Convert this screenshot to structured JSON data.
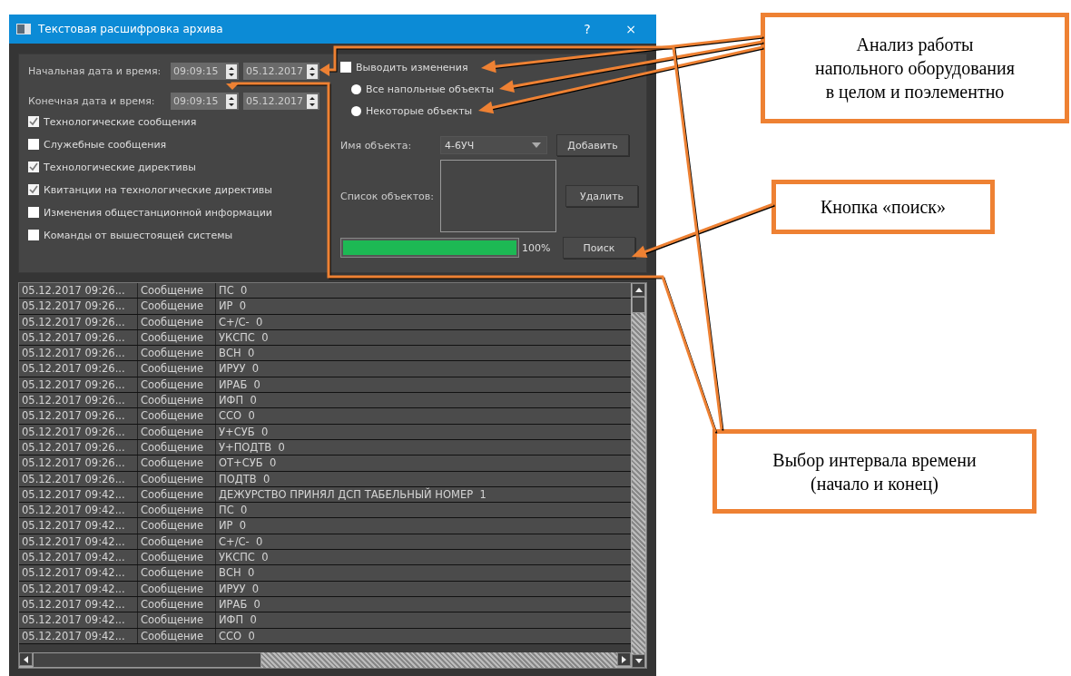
{
  "window": {
    "title": "Текстовая расшифровка архива",
    "help": "?",
    "close": "×"
  },
  "range": [
    {
      "label": "Начальная дата и время:",
      "time": "09:09:15",
      "date": "05.12.2017"
    },
    {
      "label": "Конечная дата и время:",
      "time": "09:09:15",
      "date": "05.12.2017"
    }
  ],
  "filters": [
    {
      "label": "Технологические сообщения",
      "checked": true
    },
    {
      "label": "Служебные сообщения",
      "checked": false
    },
    {
      "label": "Технологические директивы",
      "checked": true
    },
    {
      "label": "Квитанции на технологические директивы",
      "checked": true
    },
    {
      "label": "Изменения общестанционной информации",
      "checked": false
    },
    {
      "label": "Команды от вышестоящей системы",
      "checked": false
    }
  ],
  "show_changes": {
    "label": "Выводить изменения",
    "checked": false
  },
  "scope": [
    {
      "label": "Все напольные объекты",
      "selected": false
    },
    {
      "label": "Некоторые объекты",
      "selected": false
    }
  ],
  "object_name": {
    "label": "Имя объекта:",
    "value": "4-6УЧ",
    "button": "Добавить"
  },
  "object_list": {
    "label": "Список объектов:",
    "button": "Удалить"
  },
  "progress": {
    "level": 1,
    "reading": "100%"
  },
  "search_button": "Поиск",
  "rows": [
    [
      "05.12.2017 09:26...",
      "Сообщение",
      "ПС  0"
    ],
    [
      "05.12.2017 09:26...",
      "Сообщение",
      "ИР  0"
    ],
    [
      "05.12.2017 09:26...",
      "Сообщение",
      "С+/С-  0"
    ],
    [
      "05.12.2017 09:26...",
      "Сообщение",
      "УКСПС  0"
    ],
    [
      "05.12.2017 09:26...",
      "Сообщение",
      "ВСН  0"
    ],
    [
      "05.12.2017 09:26...",
      "Сообщение",
      "ИРУУ  0"
    ],
    [
      "05.12.2017 09:26...",
      "Сообщение",
      "ИРАБ  0"
    ],
    [
      "05.12.2017 09:26...",
      "Сообщение",
      "ИФП  0"
    ],
    [
      "05.12.2017 09:26...",
      "Сообщение",
      "ССО  0"
    ],
    [
      "05.12.2017 09:26...",
      "Сообщение",
      "У+СУБ  0"
    ],
    [
      "05.12.2017 09:26...",
      "Сообщение",
      "У+ПОДТВ  0"
    ],
    [
      "05.12.2017 09:26...",
      "Сообщение",
      "ОТ+СУБ  0"
    ],
    [
      "05.12.2017 09:26...",
      "Сообщение",
      "ПОДТВ  0"
    ],
    [
      "05.12.2017 09:42...",
      "Сообщение",
      "ДЕЖУРСТВО ПРИНЯЛ ДСП ТАБЕЛЬНЫЙ НОМЕР  1"
    ],
    [
      "05.12.2017 09:42...",
      "Сообщение",
      "ПС  0"
    ],
    [
      "05.12.2017 09:42...",
      "Сообщение",
      "ИР  0"
    ],
    [
      "05.12.2017 09:42...",
      "Сообщение",
      "С+/С-  0"
    ],
    [
      "05.12.2017 09:42...",
      "Сообщение",
      "УКСПС  0"
    ],
    [
      "05.12.2017 09:42...",
      "Сообщение",
      "ВСН  0"
    ],
    [
      "05.12.2017 09:42...",
      "Сообщение",
      "ИРУУ  0"
    ],
    [
      "05.12.2017 09:42...",
      "Сообщение",
      "ИРАБ  0"
    ],
    [
      "05.12.2017 09:42...",
      "Сообщение",
      "ИФП  0"
    ],
    [
      "05.12.2017 09:42...",
      "Сообщение",
      "ССО  0"
    ]
  ],
  "callouts": [
    {
      "text": "Анализ работы\nнапольного оборудования\nв целом и поэлементно"
    },
    {
      "text": "Кнопка «поиск»"
    },
    {
      "text": "Выбор интервала времени\n(начало и конец)"
    }
  ]
}
